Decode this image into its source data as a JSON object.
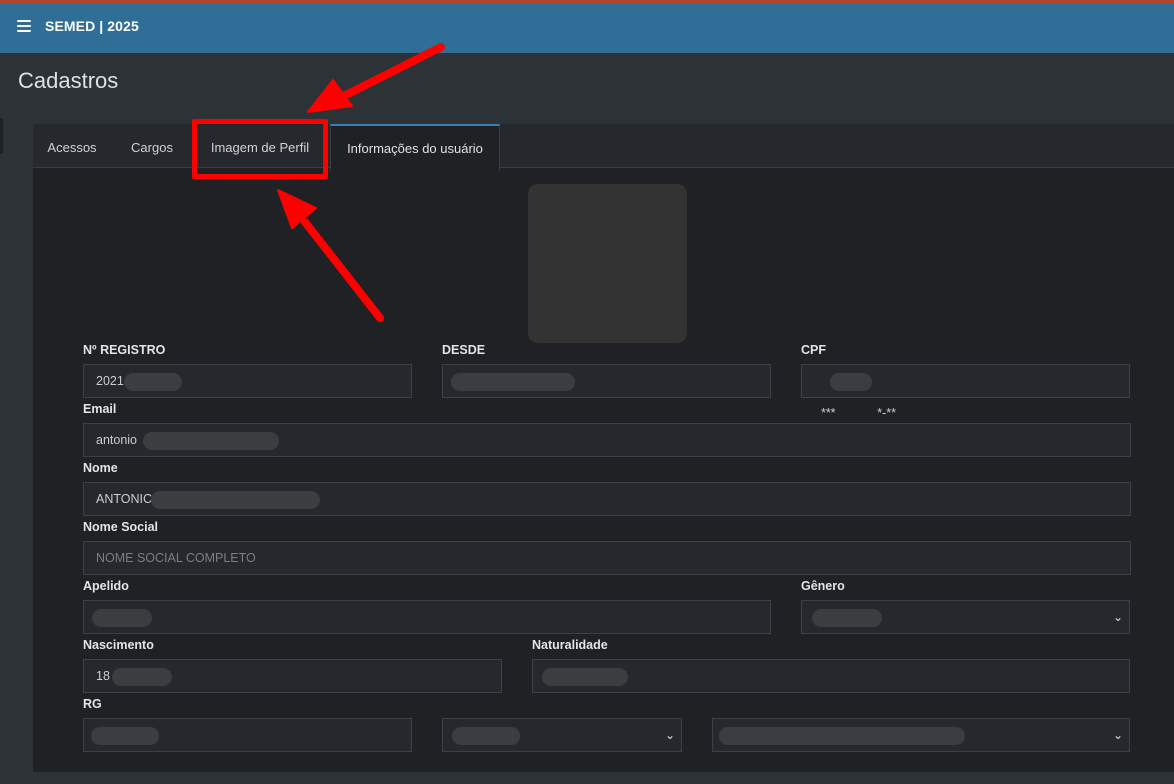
{
  "header": {
    "title": "SEMED | 2025",
    "menu_icon": "hamburger-menu-icon"
  },
  "page": {
    "title": "Cadastros"
  },
  "tabs": [
    {
      "label": "Acessos"
    },
    {
      "label": "Cargos"
    },
    {
      "label": "Imagem de Perfil"
    },
    {
      "label": "Informações do usuário"
    }
  ],
  "active_tab": "Informações do usuário",
  "form": {
    "registro": {
      "label": "Nº REGISTRO",
      "value": "2021"
    },
    "desde": {
      "label": "DESDE",
      "value": ""
    },
    "cpf": {
      "label": "CPF",
      "value": "***            *-**"
    },
    "email": {
      "label": "Email",
      "value": "antonio"
    },
    "nome": {
      "label": "Nome",
      "value": "ANTONIC"
    },
    "nome_social": {
      "label": "Nome Social",
      "placeholder": "NOME SOCIAL COMPLETO"
    },
    "apelido": {
      "label": "Apelido",
      "value": ""
    },
    "genero": {
      "label": "Gênero",
      "value": ""
    },
    "nascimento": {
      "label": "Nascimento",
      "value": "18"
    },
    "naturalidade": {
      "label": "Naturalidade",
      "value": ""
    },
    "rg": {
      "label": "RG",
      "value": ""
    }
  },
  "colors": {
    "header": "#2e6e97",
    "background": "#2d3237",
    "card": "#1f2124",
    "annotation": "#ff0000"
  }
}
